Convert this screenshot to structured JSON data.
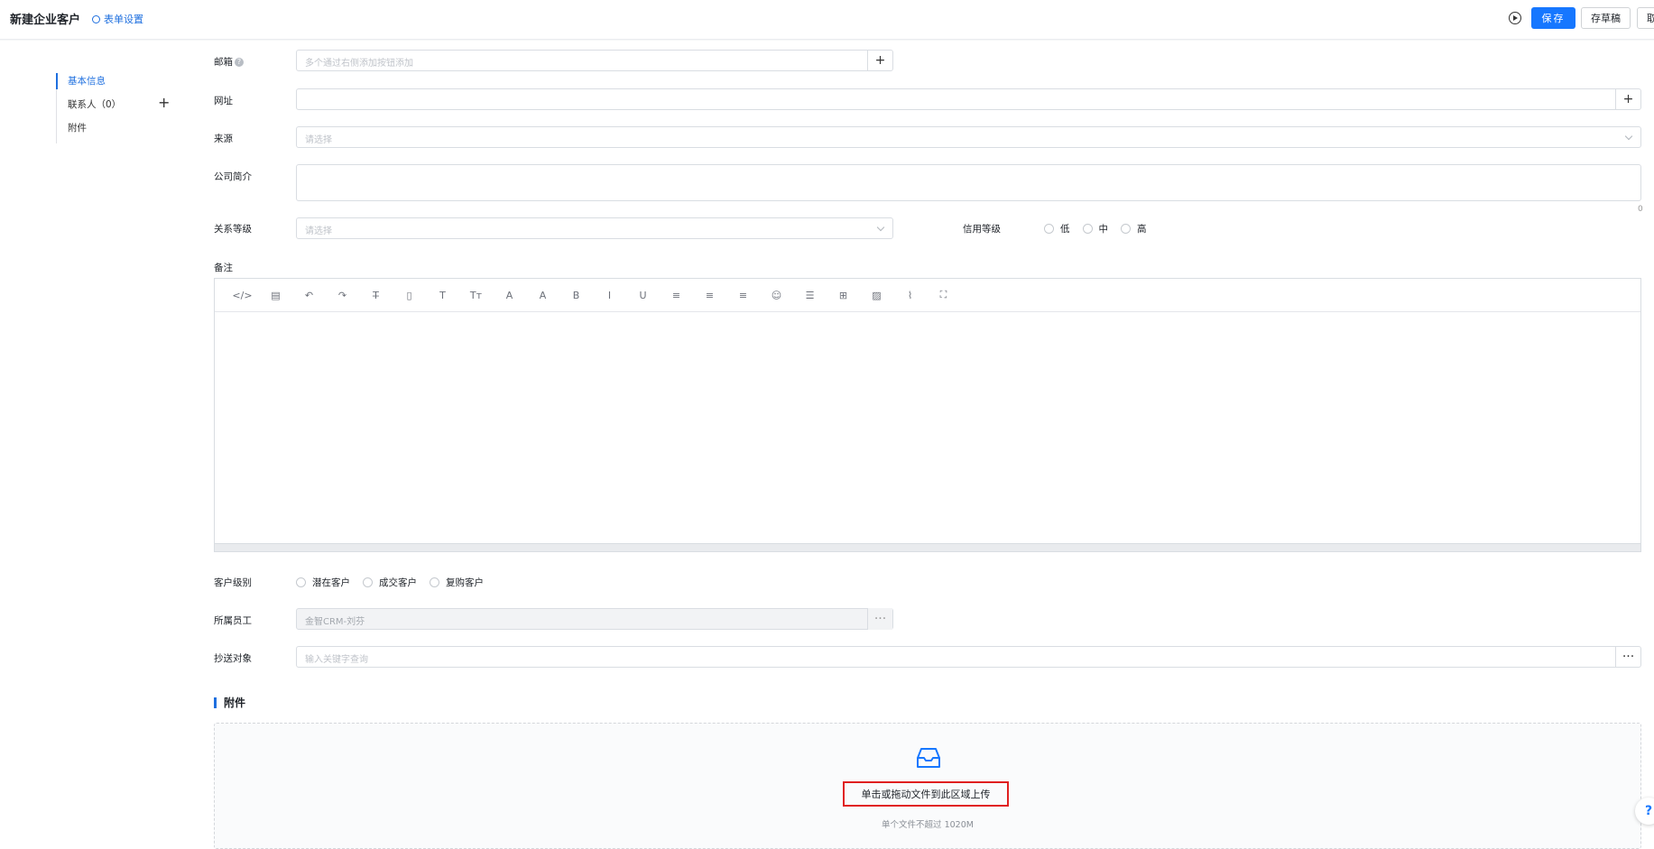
{
  "header": {
    "title": "新建企业客户",
    "form_settings": "表单设置",
    "save": "保存",
    "draft": "存草稿",
    "cancel": "取"
  },
  "sidebar": {
    "items": [
      {
        "label": "基本信息"
      },
      {
        "label": "联系人（0）"
      },
      {
        "label": "附件"
      }
    ]
  },
  "fields": {
    "email": {
      "label": "邮箱",
      "placeholder": "多个通过右侧添加按钮添加"
    },
    "website": {
      "label": "网址",
      "placeholder": ""
    },
    "source": {
      "label": "来源",
      "placeholder": "请选择"
    },
    "intro": {
      "label": "公司简介",
      "count": "0"
    },
    "relation": {
      "label": "关系等级",
      "placeholder": "请选择"
    },
    "credit": {
      "label": "信用等级",
      "options": [
        "低",
        "中",
        "高"
      ]
    },
    "remark": {
      "label": "备注"
    },
    "customer_level": {
      "label": "客户级别",
      "options": [
        "潜在客户",
        "成交客户",
        "复购客户"
      ]
    },
    "employee": {
      "label": "所属员工",
      "value": "金智CRM-刘芬"
    },
    "cc": {
      "label": "抄送对象",
      "placeholder": "输入关键字查询"
    }
  },
  "editor": {
    "tools": [
      "code-icon",
      "layout-icon",
      "undo-icon",
      "redo-icon",
      "strikethrough-icon",
      "format-icon",
      "text-icon",
      "text-size-icon",
      "font-color-icon",
      "background-color-icon",
      "bold-icon",
      "italic-icon",
      "underline-icon",
      "align-left-icon",
      "align-center-icon",
      "align-right-icon",
      "emoji-icon",
      "divider-icon",
      "table-icon",
      "image-icon",
      "attachment-icon",
      "fullscreen-icon"
    ],
    "glyphs": [
      "</>",
      "▤",
      "↶",
      "↷",
      "T̶",
      "▯",
      "T",
      "Tт",
      "A",
      "A",
      "B",
      "I",
      "U",
      "≡",
      "≡",
      "≡",
      "☺",
      "☰",
      "⊞",
      "▨",
      "⌇",
      "⛶"
    ]
  },
  "attachments": {
    "title": "附件",
    "upload": "单击或拖动文件到此区域上传",
    "hint": "单个文件不超过 1020M"
  },
  "colors": {
    "accent": "#1677ff",
    "highlight_border": "#e02020"
  }
}
